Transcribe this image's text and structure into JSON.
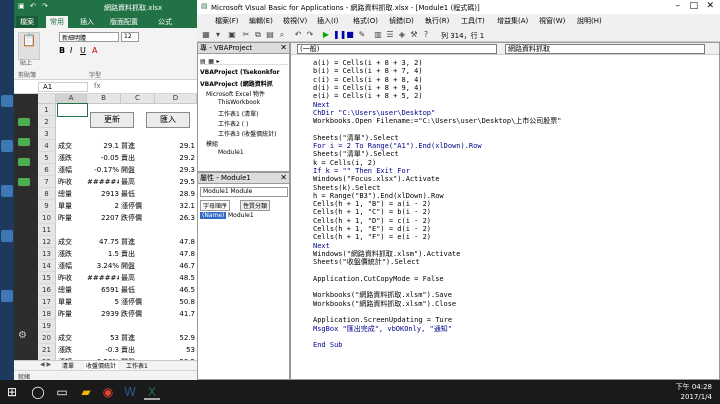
{
  "excel": {
    "title": "網路資料抓取.xlsx",
    "tabs": [
      "檔案",
      "常用",
      "插入",
      "版面配置",
      "公式"
    ],
    "ribbon": {
      "font_name": "新細明體",
      "font_size": "12",
      "clipboard_label": "剪貼簿",
      "font_label": "字型",
      "paste_label": "貼上"
    },
    "name_box": "A1",
    "columns": [
      "A",
      "B",
      "C",
      "D"
    ],
    "rows": [
      {
        "n": "1",
        "a": "",
        "b": "",
        "c": "",
        "d": ""
      },
      {
        "n": "2",
        "a": "",
        "b": "",
        "c": "",
        "d": ""
      },
      {
        "n": "3",
        "a": "",
        "b": "",
        "c": "",
        "d": ""
      },
      {
        "n": "4",
        "a": "成交",
        "b": "29.1",
        "c": "買進",
        "d": "29.1"
      },
      {
        "n": "5",
        "a": "漲跌",
        "b": "-0.05",
        "c": "賣出",
        "d": "29.2"
      },
      {
        "n": "6",
        "a": "漲幅",
        "b": "-0.17%",
        "c": "開盤",
        "d": "29.3"
      },
      {
        "n": "7",
        "a": "昨收",
        "b": "######",
        "c": "最高",
        "d": "29.5"
      },
      {
        "n": "8",
        "a": "總量",
        "b": "2913",
        "c": "最低",
        "d": "28.9"
      },
      {
        "n": "9",
        "a": "單量",
        "b": "2",
        "c": "漲停價",
        "d": "32.1"
      },
      {
        "n": "10",
        "a": "昨量",
        "b": "2207",
        "c": "跌停價",
        "d": "26.3"
      },
      {
        "n": "11",
        "a": "",
        "b": "",
        "c": "",
        "d": ""
      },
      {
        "n": "12",
        "a": "成交",
        "b": "47.75",
        "c": "買進",
        "d": "47.8"
      },
      {
        "n": "13",
        "a": "漲跌",
        "b": "1.5",
        "c": "賣出",
        "d": "47.8"
      },
      {
        "n": "14",
        "a": "漲幅",
        "b": "3.24%",
        "c": "開盤",
        "d": "46.7"
      },
      {
        "n": "15",
        "a": "昨收",
        "b": "######",
        "c": "最高",
        "d": "48.5"
      },
      {
        "n": "16",
        "a": "總量",
        "b": "6591",
        "c": "最低",
        "d": "46.5"
      },
      {
        "n": "17",
        "a": "單量",
        "b": "5",
        "c": "漲停價",
        "d": "50.8"
      },
      {
        "n": "18",
        "a": "昨量",
        "b": "2939",
        "c": "跌停價",
        "d": "41.7"
      },
      {
        "n": "19",
        "a": "",
        "b": "",
        "c": "",
        "d": ""
      },
      {
        "n": "20",
        "a": "成交",
        "b": "53",
        "c": "買進",
        "d": "52.9"
      },
      {
        "n": "21",
        "a": "漲跌",
        "b": "-0.3",
        "c": "賣出",
        "d": "53"
      },
      {
        "n": "22",
        "a": "漲幅",
        "b": "-0.56%",
        "c": "開盤",
        "d": "53.5"
      }
    ],
    "buttons": {
      "update": "更新",
      "import": "匯入"
    },
    "sheet_tabs": [
      "清單",
      "收盤價統計",
      "工作表1"
    ],
    "status": "就緒"
  },
  "vba": {
    "title": "Microsoft Visual Basic for Applications - 網路資料抓取.xlsx - [Module1 (程式碼)]",
    "menus": [
      "檔案(F)",
      "編輯(E)",
      "檢視(V)",
      "插入(I)",
      "格式(O)",
      "偵錯(D)",
      "執行(R)",
      "工具(T)",
      "增益集(A)",
      "視窗(W)",
      "說明(H)"
    ],
    "position": "列 314，行 1",
    "project_title": "專 - VBAProject",
    "project_tree": [
      "VBAProject (Tsekonkfor",
      "VBAProject (網路資料抓",
      "Microsoft Excel 物件",
      "ThisWorkbook",
      "工作表1 (清單)",
      "工作表2 ( )",
      "工作表3 (收盤價統計)",
      "模組",
      "Module1"
    ],
    "props_title": "屬性 - Module1",
    "props_combo": "Module1 Module",
    "props_tabs": [
      "字母順序",
      "性質分類"
    ],
    "props_row": {
      "key": "(Name)",
      "value": "Module1"
    },
    "combo_left": "(一般)",
    "combo_right": "網路資料抓取",
    "code": [
      "a(i) = Cells(i + 8 + 3, 2)",
      "b(i) = Cells(i + 8 + 7, 4)",
      "c(i) = Cells(i + 8 + 8, 4)",
      "d(i) = Cells(i + 8 + 9, 4)",
      "e(i) = Cells(i + 8 + 5, 2)",
      "Next",
      "ChDir \"C:\\Users\\user\\Desktop\"",
      "Workbooks.Open Filename:=\"C:\\Users\\user\\Desktop\\上市公司股票\"",
      "",
      "Sheets(\"清單\").Select",
      "For i = 2 To Range(\"A1\").End(xlDown).Row",
      "Sheets(\"清單\").Select",
      "k = Cells(i, 2)",
      "If k = \"\" Then Exit For",
      "Windows(\"Focus.xlsx\").Activate",
      "Sheets(k).Select",
      "h = Range(\"B3\").End(xlDown).Row",
      "Cells(h + 1, \"B\") = a(i - 2)",
      "Cells(h + 1, \"C\") = b(i - 2)",
      "Cells(h + 1, \"D\") = c(i - 2)",
      "Cells(h + 1, \"E\") = d(i - 2)",
      "Cells(h + 1, \"F\") = e(i - 2)",
      "Next",
      "Windows(\"網路資料抓取.xlsm\").Activate",
      "Sheets(\"收盤價統計\").Select",
      "",
      "Application.CutCopyMode = False",
      "",
      "Workbooks(\"網路資料抓取.xlsm\").Save",
      "Workbooks(\"網路資料抓取.xlsm\").Close",
      "",
      "Application.ScreenUpdating = Ture",
      "MsgBox \"匯出完成\", vbOKOnly, \"通知\"",
      "",
      "End Sub"
    ]
  },
  "taskbar": {
    "time": "下午 04:28",
    "date": "2017/1/4"
  }
}
